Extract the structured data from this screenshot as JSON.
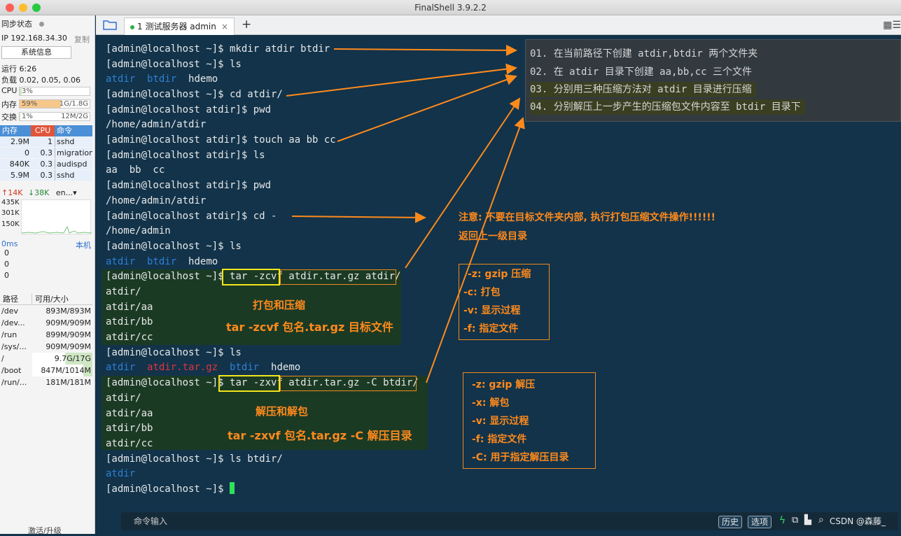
{
  "window": {
    "title": "FinalShell 3.9.2.2"
  },
  "sidebar": {
    "sync_label": "同步状态",
    "ip_label": "IP 192.168.34.30",
    "copy_label": "复制",
    "sysinfo_button": "系统信息",
    "uptime": "运行 6:26",
    "load": "负载 0.02, 0.05, 0.06",
    "cpu": {
      "label": "CPU",
      "value": "3%",
      "percent": 3
    },
    "mem": {
      "label": "内存",
      "percent_text": "59%",
      "value": "1G/1.8G",
      "percent": 59
    },
    "swap": {
      "label": "交换",
      "percent_text": "1%",
      "value": "12M/2G",
      "percent": 1
    },
    "proc_headers": [
      "内存",
      "CPU",
      "命令"
    ],
    "procs": [
      [
        "2.9M",
        "1",
        "sshd"
      ],
      [
        "0",
        "0.3",
        "migration"
      ],
      [
        "840K",
        "0.3",
        "audispd"
      ],
      [
        "5.9M",
        "0.3",
        "sshd"
      ]
    ],
    "net": {
      "up": "14K",
      "down": "38K",
      "iface": "en...",
      "levels": [
        "435K",
        "301K",
        "150K"
      ]
    },
    "ping": {
      "latency": "0ms",
      "host": "本机",
      "values": [
        "0",
        "0",
        "0"
      ]
    },
    "fs_headers": [
      "路径",
      "可用/大小"
    ],
    "fs": [
      [
        "/dev",
        "893M/893M"
      ],
      [
        "/dev...",
        "909M/909M"
      ],
      [
        "/run",
        "899M/909M"
      ],
      [
        "/sys/...",
        "909M/909M"
      ],
      [
        "/",
        "9.7G/17G"
      ],
      [
        "/boot",
        "847M/1014M"
      ],
      [
        "/run/...",
        "181M/181M"
      ]
    ],
    "activate": "激活/升级"
  },
  "tabs": [
    {
      "label": "1 测试服务器 admin",
      "status_color": "#2cb34a"
    }
  ],
  "terminal": {
    "lines": [
      "[admin@localhost ~]$ mkdir atdir btdir",
      "[admin@localhost ~]$ ls",
      "",
      "[admin@localhost ~]$ cd atdir/",
      "[admin@localhost atdir]$ pwd",
      "/home/admin/atdir",
      "[admin@localhost atdir]$ touch aa bb cc",
      "[admin@localhost atdir]$ ls",
      "aa  bb  cc",
      "[admin@localhost atdir]$ pwd",
      "/home/admin/atdir",
      "[admin@localhost atdir]$ cd -",
      "/home/admin",
      "[admin@localhost ~]$ ls",
      "",
      "[admin@localhost ~]$ ",
      "atdir/",
      "atdir/aa",
      "atdir/bb",
      "atdir/cc",
      "[admin@localhost ~]$ ls",
      "",
      "[admin@localhost ~]$ ",
      "atdir/",
      "atdir/aa",
      "atdir/bb",
      "atdir/cc",
      "[admin@localhost ~]$ ls btdir/",
      "",
      "[admin@localhost ~]$ "
    ],
    "ls1": {
      "dir1": "atdir",
      "dir2": "btdir",
      "file": "hdemo"
    },
    "ls2": {
      "dir1": "atdir",
      "dir2": "btdir",
      "file": "hdemo"
    },
    "ls3": {
      "dir1": "atdir",
      "arch": "atdir.tar.gz",
      "dir2": "btdir",
      "file": "hdemo"
    },
    "ls4": {
      "dir1": "atdir"
    },
    "tar1": {
      "cmd": "tar -zcvf",
      "rest": " atdir.tar.gz atdir/"
    },
    "tar2": {
      "cmd": "tar -zxvf",
      "rest": " atdir.tar.gz -C btdir/"
    },
    "dir_color": "#2f7fd6",
    "archive_color": "#e0343c",
    "cursor_color": "#2ee05a"
  },
  "notes": [
    "01. 在当前路径下创建 atdir,btdir 两个文件夹",
    "02. 在 atdir 目录下创建 aa,bb,cc 三个文件",
    "03. 分别用三种压缩方法对 atdir 目录进行压缩",
    "04. 分别解压上一步产生的压缩包文件内容至 btdir 目录下"
  ],
  "annotations": {
    "warning1": "注意: 不要在目标文件夹内部, 执行打包压缩文件操作!!!!!!",
    "warning2": "返回上一级目录",
    "pack_title": "打包和压缩",
    "pack_syntax": "tar -zcvf 包名.tar.gz 目标文件",
    "unpack_title": "解压和解包",
    "unpack_syntax": "tar -zxvf 包名.tar.gz -C 解压目录",
    "box1": [
      "-z: gzip 压缩",
      "-c: 打包",
      "-v: 显示过程",
      "-f: 指定文件"
    ],
    "box2": [
      "-z: gzip 解压",
      "-x: 解包",
      "-v: 显示过程",
      "-f: 指定文件",
      "-C: 用于指定解压目录"
    ],
    "accent_color": "#ff8a1c"
  },
  "cmdbar": {
    "placeholder": "命令输入",
    "history": "历史",
    "options": "选项",
    "watermark": "CSDN @森藤_"
  }
}
